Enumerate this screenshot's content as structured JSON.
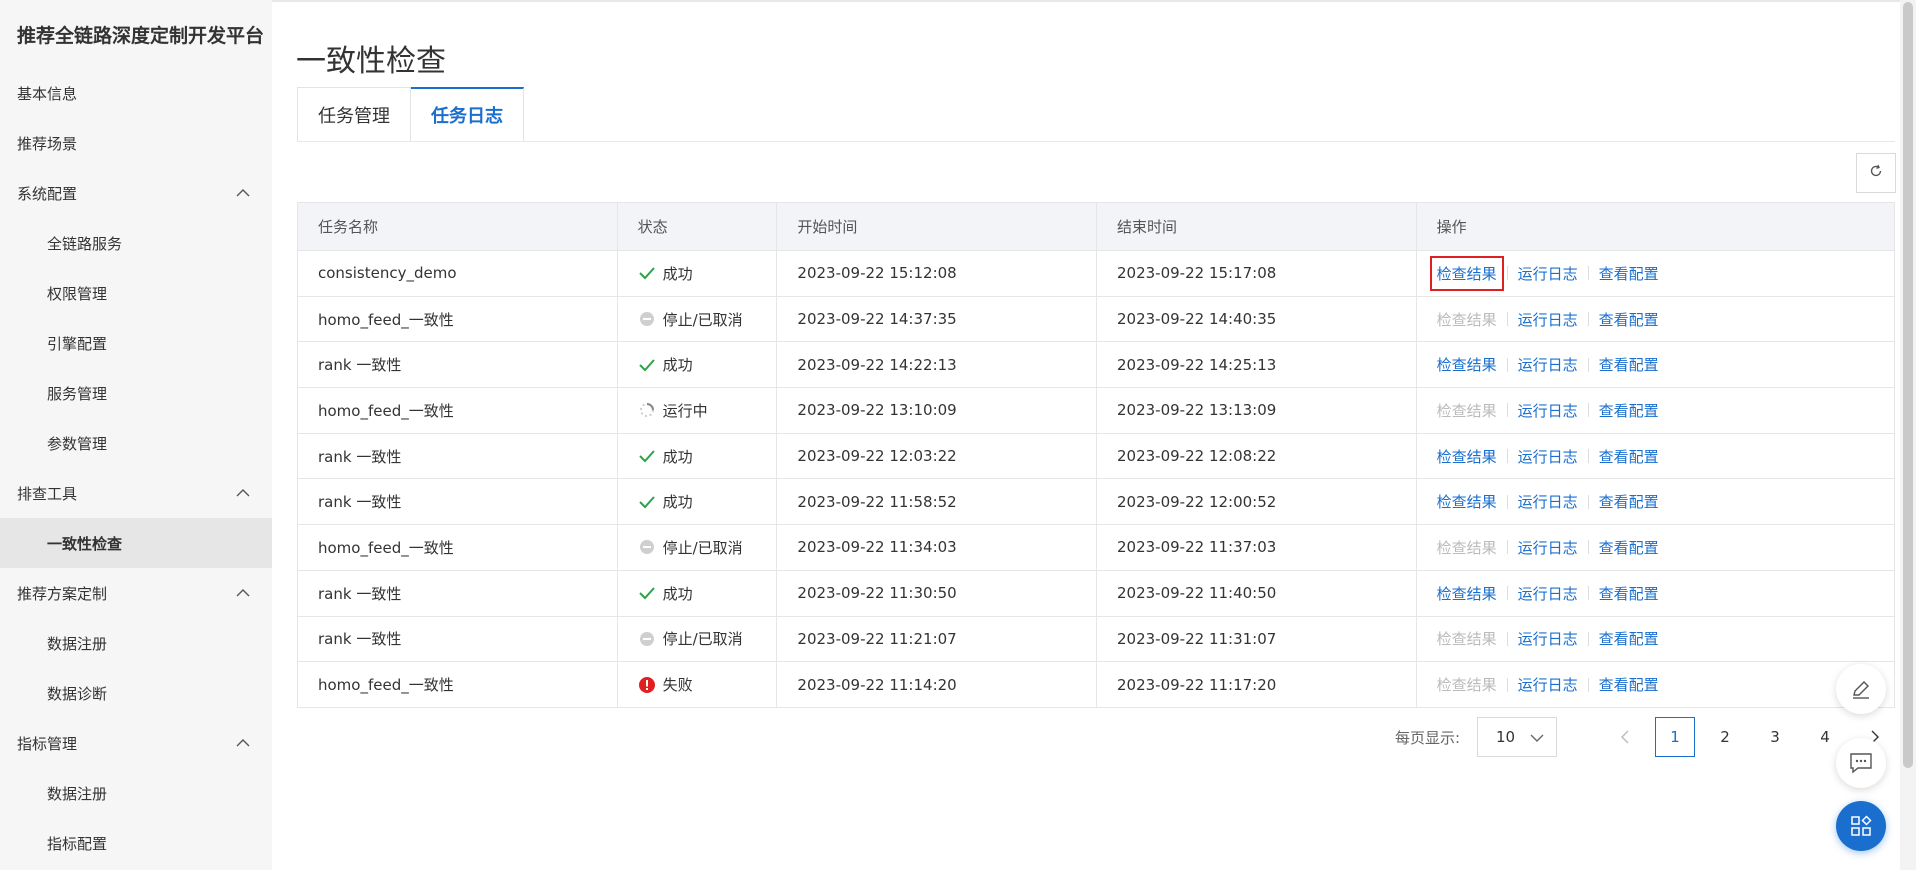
{
  "brand": "推荐全链路深度定制开发平台",
  "sidebar": {
    "items": [
      {
        "label": "基本信息"
      },
      {
        "label": "推荐场景"
      },
      {
        "label": "系统配置"
      },
      {
        "label": "全链路服务"
      },
      {
        "label": "权限管理"
      },
      {
        "label": "引擎配置"
      },
      {
        "label": "服务管理"
      },
      {
        "label": "参数管理"
      },
      {
        "label": "排查工具"
      },
      {
        "label": "一致性检查"
      },
      {
        "label": "推荐方案定制"
      },
      {
        "label": "数据注册"
      },
      {
        "label": "数据诊断"
      },
      {
        "label": "指标管理"
      },
      {
        "label": "数据注册"
      },
      {
        "label": "指标配置"
      }
    ]
  },
  "page": {
    "title": "一致性检查"
  },
  "tabs": [
    {
      "label": "任务管理"
    },
    {
      "label": "任务日志"
    }
  ],
  "table": {
    "headers": [
      "任务名称",
      "状态",
      "开始时间",
      "结束时间",
      "操作"
    ],
    "op_labels": {
      "check": "检查结果",
      "log": "运行日志",
      "config": "查看配置"
    },
    "rows": [
      {
        "name": "consistency_demo",
        "status": "成功",
        "start": "2023-09-22 15:12:08",
        "end": "2023-09-22 15:17:08"
      },
      {
        "name": "homo_feed_一致性",
        "status": "停止/已取消",
        "start": "2023-09-22 14:37:35",
        "end": "2023-09-22 14:40:35"
      },
      {
        "name": "rank 一致性",
        "status": "成功",
        "start": "2023-09-22 14:22:13",
        "end": "2023-09-22 14:25:13"
      },
      {
        "name": "homo_feed_一致性",
        "status": "运行中",
        "start": "2023-09-22 13:10:09",
        "end": "2023-09-22 13:13:09"
      },
      {
        "name": "rank 一致性",
        "status": "成功",
        "start": "2023-09-22 12:03:22",
        "end": "2023-09-22 12:08:22"
      },
      {
        "name": "rank 一致性",
        "status": "成功",
        "start": "2023-09-22 11:58:52",
        "end": "2023-09-22 12:00:52"
      },
      {
        "name": "homo_feed_一致性",
        "status": "停止/已取消",
        "start": "2023-09-22 11:34:03",
        "end": "2023-09-22 11:37:03"
      },
      {
        "name": "rank 一致性",
        "status": "成功",
        "start": "2023-09-22 11:30:50",
        "end": "2023-09-22 11:40:50"
      },
      {
        "name": "rank 一致性",
        "status": "停止/已取消",
        "start": "2023-09-22 11:21:07",
        "end": "2023-09-22 11:31:07"
      },
      {
        "name": "homo_feed_一致性",
        "status": "失败",
        "start": "2023-09-22 11:14:20",
        "end": "2023-09-22 11:17:20"
      }
    ]
  },
  "pagination": {
    "label": "每页显示:",
    "page_size": "10",
    "pages": [
      "1",
      "2",
      "3",
      "4"
    ]
  },
  "colors": {
    "accent": "#1a6fce",
    "success": "#2aa34a",
    "error": "#e02020",
    "disabled": "#bbbbbb"
  }
}
